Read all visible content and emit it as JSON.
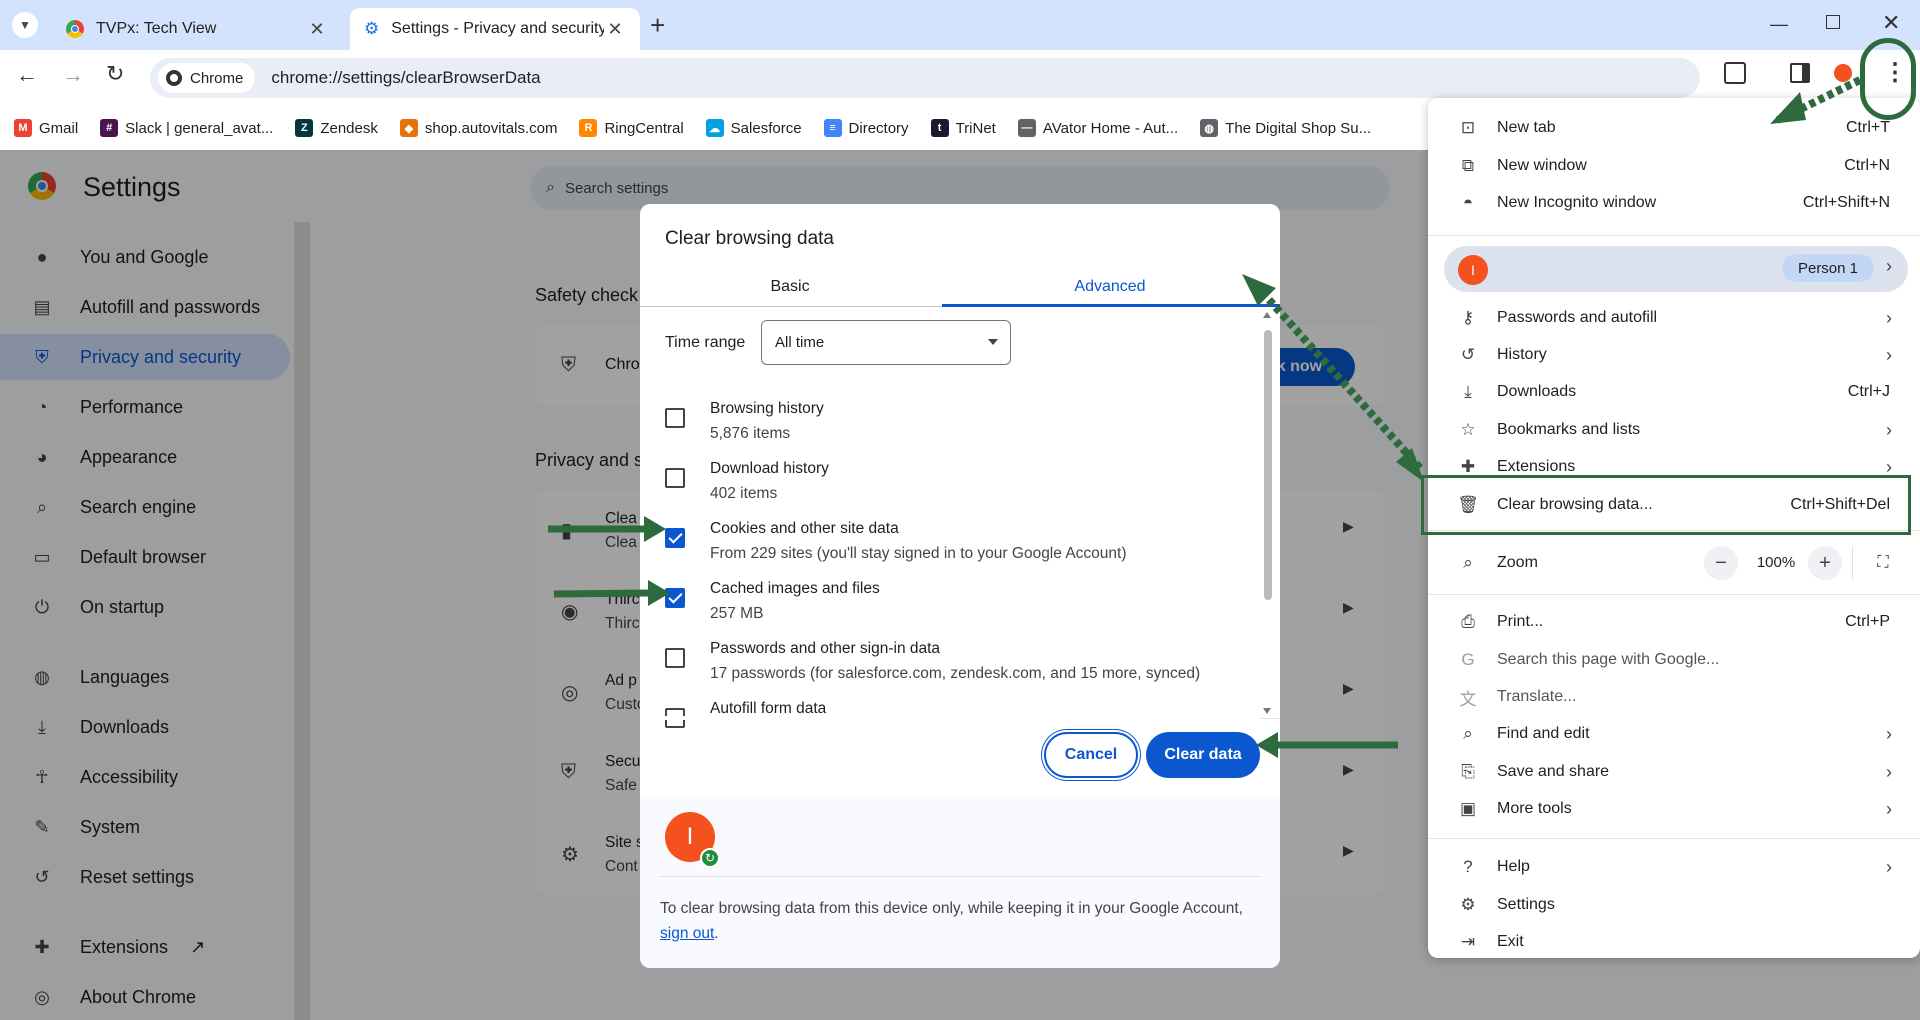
{
  "browser": {
    "tabs": [
      {
        "title": "TVPx: Tech View",
        "close": "✕"
      },
      {
        "title": "Settings - Privacy and security",
        "close": "✕"
      }
    ],
    "new_tab_symbol": "+",
    "chip_label": "Chrome",
    "url": "chrome://settings/clearBrowserData",
    "bookmarks": [
      {
        "label": "Gmail",
        "icon": "gmail-icon",
        "color": "#ea4335"
      },
      {
        "label": "Slack | general_avat...",
        "icon": "slack-icon",
        "color": "#4a154b"
      },
      {
        "label": "Zendesk",
        "icon": "zendesk-icon",
        "color": "#03363d"
      },
      {
        "label": "shop.autovitals.com",
        "icon": "autovitals-icon",
        "color": "#e8710a"
      },
      {
        "label": "RingCentral",
        "icon": "ringcentral-icon",
        "color": "#ff8800"
      },
      {
        "label": "Salesforce",
        "icon": "salesforce-icon",
        "color": "#00a1e0"
      },
      {
        "label": "Directory",
        "icon": "docs-icon",
        "color": "#4285f4"
      },
      {
        "label": "TriNet",
        "icon": "trinet-icon",
        "color": "#1a1a2e"
      },
      {
        "label": "AVator Home - Aut...",
        "icon": "avator-icon",
        "color": "#5f6368"
      },
      {
        "label": "The Digital Shop Su...",
        "icon": "globe-icon",
        "color": "#5f6368"
      }
    ]
  },
  "settings": {
    "title": "Settings",
    "search_placeholder": "Search settings",
    "sidebar": [
      {
        "label": "You and Google",
        "icon": "person-icon"
      },
      {
        "label": "Autofill and passwords",
        "icon": "clipboard-icon"
      },
      {
        "label": "Privacy and security",
        "icon": "shield-icon",
        "active": true
      },
      {
        "label": "Performance",
        "icon": "speedometer-icon"
      },
      {
        "label": "Appearance",
        "icon": "palette-icon"
      },
      {
        "label": "Search engine",
        "icon": "search-icon"
      },
      {
        "label": "Default browser",
        "icon": "browser-icon"
      },
      {
        "label": "On startup",
        "icon": "power-icon"
      },
      {
        "label": "Languages",
        "icon": "globe-icon"
      },
      {
        "label": "Downloads",
        "icon": "download-icon"
      },
      {
        "label": "Accessibility",
        "icon": "accessibility-icon"
      },
      {
        "label": "System",
        "icon": "wrench-icon"
      },
      {
        "label": "Reset settings",
        "icon": "reset-icon"
      },
      {
        "label": "Extensions",
        "icon": "puzzle-icon"
      },
      {
        "label": "About Chrome",
        "icon": "chrome-icon"
      }
    ],
    "safety_check_heading": "Safety check",
    "safety_check_text": "Chro",
    "check_now_fragment": "ck now",
    "privacy_heading": "Privacy and s",
    "privacy_rows": [
      {
        "title": "Clea",
        "sub": "Clea"
      },
      {
        "title": "Thirc",
        "sub": "Thirc"
      },
      {
        "title": "Ad p",
        "sub": "Custo"
      },
      {
        "title": "Secu",
        "sub": "Safe"
      },
      {
        "title": "Site s",
        "sub": "Cont"
      }
    ]
  },
  "dialog": {
    "title": "Clear browsing data",
    "tabs": {
      "basic": "Basic",
      "advanced": "Advanced"
    },
    "time_range_label": "Time range",
    "time_range_value": "All time",
    "items": [
      {
        "title": "Browsing history",
        "sub": "5,876 items",
        "checked": false
      },
      {
        "title": "Download history",
        "sub": "402 items",
        "checked": false
      },
      {
        "title": "Cookies and other site data",
        "sub": "From 229 sites (you'll stay signed in to your Google Account)",
        "checked": true
      },
      {
        "title": "Cached images and files",
        "sub": "257 MB",
        "checked": true
      },
      {
        "title": "Passwords and other sign-in data",
        "sub": "17 passwords (for salesforce.com, zendesk.com, and 15 more, synced)",
        "checked": false
      },
      {
        "title": "Autofill form data",
        "sub": "",
        "checked": false
      }
    ],
    "cancel_label": "Cancel",
    "clear_label": "Clear data",
    "avatar_letter": "I",
    "notice_text": "To clear browsing data from this device only, while keeping it in your Google Account,",
    "signout_link": "sign out",
    "notice_end": "."
  },
  "menu": {
    "items_top": [
      {
        "label": "New tab",
        "shortcut": "Ctrl+T",
        "icon": "new-tab-icon"
      },
      {
        "label": "New window",
        "shortcut": "Ctrl+N",
        "icon": "new-window-icon"
      },
      {
        "label": "New Incognito window",
        "shortcut": "Ctrl+Shift+N",
        "icon": "incognito-icon"
      }
    ],
    "profile_letter": "I",
    "profile_name": "Person 1",
    "items_mid": [
      {
        "label": "Passwords and autofill",
        "icon": "key-icon",
        "submenu": true
      },
      {
        "label": "History",
        "icon": "history-icon",
        "submenu": true
      },
      {
        "label": "Downloads",
        "icon": "download-icon",
        "shortcut": "Ctrl+J"
      },
      {
        "label": "Bookmarks and lists",
        "icon": "star-icon",
        "submenu": true
      },
      {
        "label": "Extensions",
        "icon": "puzzle-icon",
        "submenu": true
      },
      {
        "label": "Clear browsing data...",
        "icon": "trash-icon",
        "shortcut": "Ctrl+Shift+Del"
      }
    ],
    "zoom_label": "Zoom",
    "zoom_value": "100%",
    "zoom_minus": "−",
    "zoom_plus": "+",
    "items_tools": [
      {
        "label": "Print...",
        "icon": "print-icon",
        "shortcut": "Ctrl+P"
      },
      {
        "label": "Search this page with Google...",
        "icon": "google-icon",
        "disabled": true
      },
      {
        "label": "Translate...",
        "icon": "translate-icon",
        "disabled": true
      },
      {
        "label": "Find and edit",
        "icon": "find-icon",
        "submenu": true
      },
      {
        "label": "Save and share",
        "icon": "save-icon",
        "submenu": true
      },
      {
        "label": "More tools",
        "icon": "toolbox-icon",
        "submenu": true
      }
    ],
    "items_bottom": [
      {
        "label": "Help",
        "icon": "help-icon",
        "submenu": true
      },
      {
        "label": "Settings",
        "icon": "gear-icon"
      },
      {
        "label": "Exit",
        "icon": "exit-icon"
      }
    ]
  },
  "colors": {
    "accent": "#0b57d0",
    "annotation_green": "#2d6b3e",
    "avatar": "#f4511e"
  }
}
